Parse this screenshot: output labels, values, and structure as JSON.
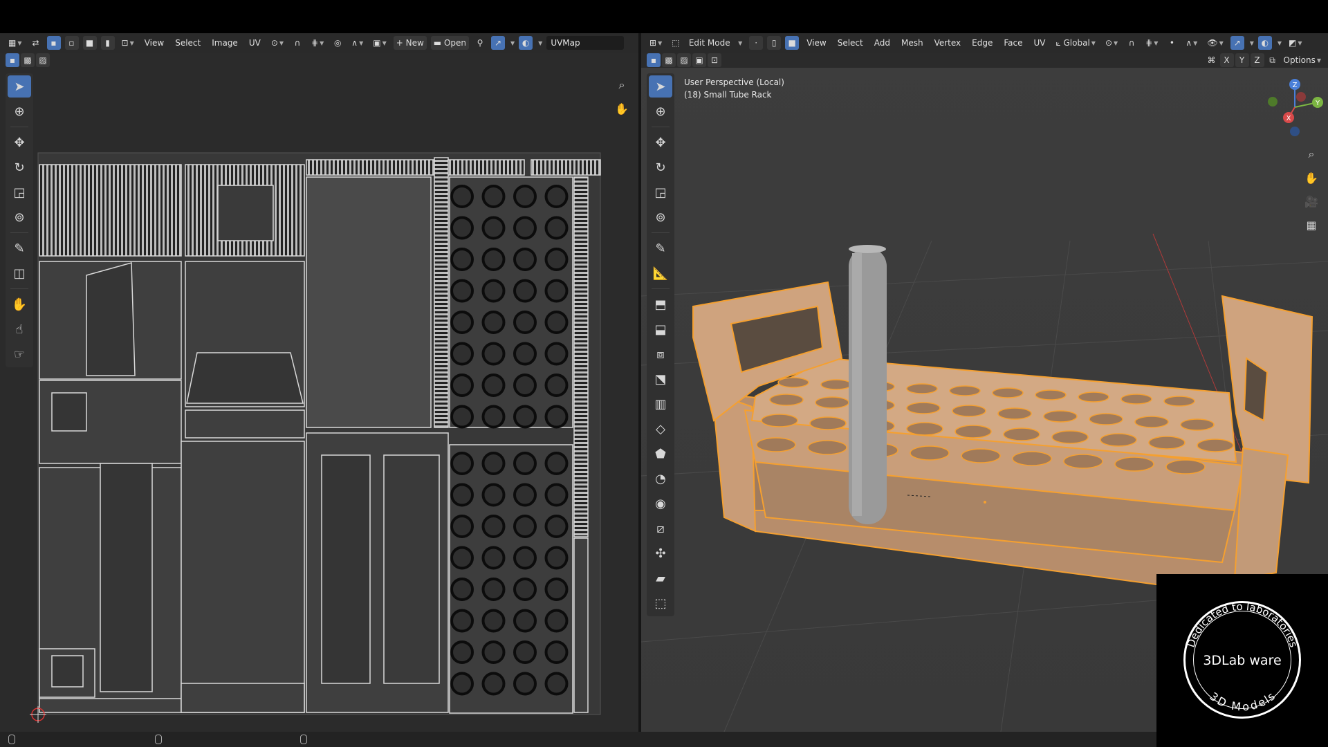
{
  "uv_editor": {
    "header": {
      "menus": [
        "View",
        "Select",
        "Image",
        "UV"
      ],
      "new_label": "New",
      "open_label": "Open",
      "uvmap_name": "UVMap"
    }
  },
  "viewport": {
    "header": {
      "mode": "Edit Mode",
      "menus": [
        "View",
        "Select",
        "Add",
        "Mesh",
        "Vertex",
        "Edge",
        "Face",
        "UV"
      ],
      "orientation": "Global",
      "options_label": "Options",
      "axis_labels": [
        "X",
        "Y",
        "Z"
      ]
    },
    "info": {
      "perspective": "User Perspective (Local)",
      "object": "(18) Small Tube Rack"
    },
    "gizmo": {
      "z": "Z",
      "y": "Y",
      "x": "X"
    }
  },
  "watermark": {
    "arc_top": "Dedicated to laboratories",
    "brand": "3DLab ware",
    "arc_bottom": "3D Models"
  },
  "colors": {
    "selection_orange": "#f5a030",
    "active_blue": "#4772b3",
    "mesh_fill": "#c79a73",
    "uv_background": "#2b2b2b",
    "viewport_background": "#3a3a3a"
  }
}
